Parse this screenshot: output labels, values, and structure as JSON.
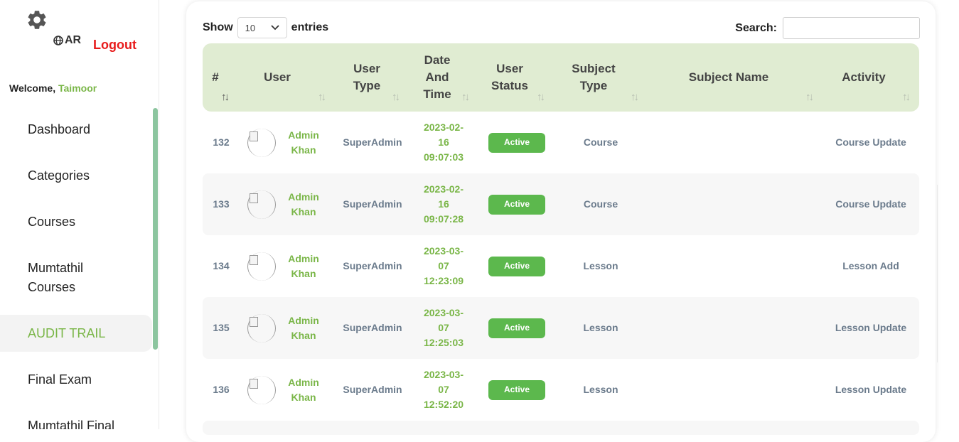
{
  "sidebar": {
    "lang_label": "AR",
    "logout_label": "Logout",
    "welcome_prefix": "Welcome,",
    "username": "Taimoor",
    "items": [
      {
        "label": "Dashboard"
      },
      {
        "label": "Categories"
      },
      {
        "label": "Courses"
      },
      {
        "label": "Mumtathil Courses"
      },
      {
        "label": "AUDIT TRAIL",
        "active": true
      },
      {
        "label": "Final Exam"
      },
      {
        "label": "Mumtathil Final"
      }
    ]
  },
  "controls": {
    "show_label": "Show",
    "page_length": "10",
    "entries_label": "entries",
    "search_label": "Search:",
    "search_value": ""
  },
  "table": {
    "headers": [
      "#",
      "User",
      "User Type",
      "Date And Time",
      "User Status",
      "Subject Type",
      "Subject Name",
      "Activity"
    ],
    "rows": [
      {
        "id": "132",
        "user": "Admin Khan",
        "user_type": "SuperAdmin",
        "date1": "2023-02-",
        "date2": "16",
        "time": "09:07:03",
        "status": "Active",
        "subject_type": "Course",
        "subject_name": "",
        "activity": "Course Update"
      },
      {
        "id": "133",
        "user": "Admin Khan",
        "user_type": "SuperAdmin",
        "date1": "2023-02-",
        "date2": "16",
        "time": "09:07:28",
        "status": "Active",
        "subject_type": "Course",
        "subject_name": "",
        "activity": "Course Update"
      },
      {
        "id": "134",
        "user": "Admin Khan",
        "user_type": "SuperAdmin",
        "date1": "2023-03-",
        "date2": "07",
        "time": "12:23:09",
        "status": "Active",
        "subject_type": "Lesson",
        "subject_name": "",
        "activity": "Lesson Add"
      },
      {
        "id": "135",
        "user": "Admin Khan",
        "user_type": "SuperAdmin",
        "date1": "2023-03-",
        "date2": "07",
        "time": "12:25:03",
        "status": "Active",
        "subject_type": "Lesson",
        "subject_name": "",
        "activity": "Lesson Update"
      },
      {
        "id": "136",
        "user": "Admin Khan",
        "user_type": "SuperAdmin",
        "date1": "2023-03-",
        "date2": "07",
        "time": "12:52:20",
        "status": "Active",
        "subject_type": "Lesson",
        "subject_name": "",
        "activity": "Lesson Update"
      }
    ]
  },
  "colors": {
    "accent": "#7ab648",
    "header_bg": "#e0ecd2",
    "badge": "#5cb84d",
    "logout": "#e81b1b"
  }
}
